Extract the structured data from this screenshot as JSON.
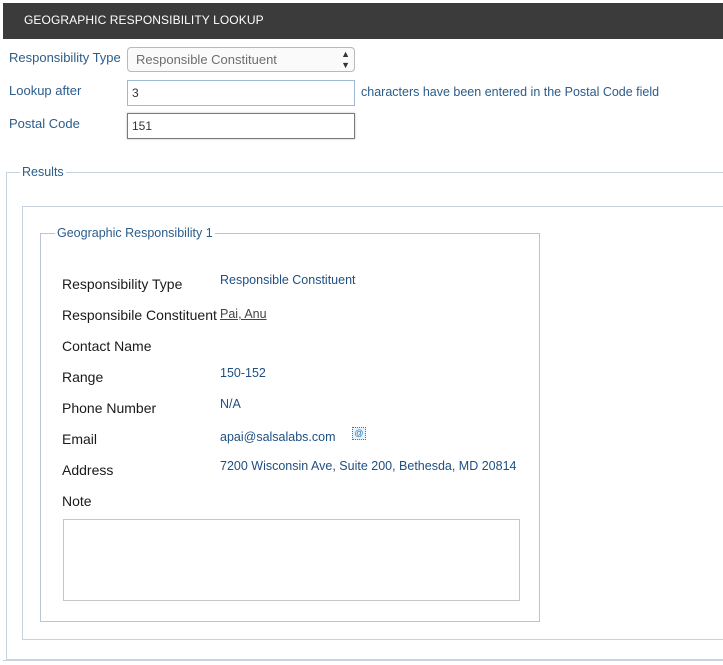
{
  "header": {
    "title": "GEOGRAPHIC RESPONSIBILITY LOOKUP"
  },
  "form": {
    "responsibility_type_label": "Responsibility Type",
    "responsibility_type_value": "Responsible Constituent",
    "lookup_after_label": "Lookup after",
    "lookup_after_value": "3",
    "lookup_after_hint": "characters have been entered in the Postal Code field",
    "postal_code_label": "Postal Code",
    "postal_code_value": "151"
  },
  "results": {
    "legend": "Results",
    "card": {
      "legend": "Geographic Responsibility 1",
      "rows": {
        "responsibility_type": {
          "label": "Responsibility Type",
          "value": "Responsible Constituent"
        },
        "responsible_constituent": {
          "label": "Responsibile Constituent",
          "value": "Pai, Anu"
        },
        "contact_name": {
          "label": "Contact Name",
          "value": ""
        },
        "range": {
          "label": "Range",
          "value": "150-152"
        },
        "phone": {
          "label": "Phone Number",
          "value": "N/A"
        },
        "email": {
          "label": "Email",
          "value": "apai@salsalabs.com"
        },
        "address": {
          "label": "Address",
          "value": "7200 Wisconsin Ave, Suite 200, Bethesda, MD 20814"
        },
        "note": {
          "label": "Note",
          "value": ""
        }
      }
    }
  },
  "icons": {
    "email_action": "email-icon",
    "select_arrows": "updown-arrows-icon"
  }
}
